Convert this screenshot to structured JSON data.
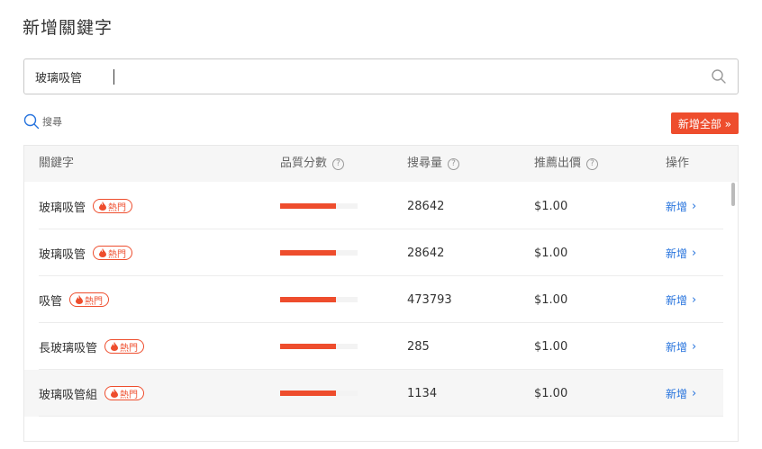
{
  "page": {
    "title": "新增關鍵字"
  },
  "search": {
    "value": "玻璃吸管",
    "placeholder": ""
  },
  "search_link": {
    "label": "搜尋"
  },
  "add_all": {
    "label": "新增全部 »"
  },
  "colors": {
    "accent": "#ee4d2d",
    "link": "#2673dd"
  },
  "table": {
    "headers": {
      "keyword": "關鍵字",
      "quality": "品質分數",
      "volume": "搜尋量",
      "bid": "推薦出價",
      "action": "操作"
    },
    "hot_label": "熱門",
    "add_label": "新增",
    "rows": [
      {
        "keyword": "玻璃吸管",
        "quality": 0.72,
        "volume": "28642",
        "bid": "$1.00"
      },
      {
        "keyword": "玻璃吸管",
        "quality": 0.72,
        "volume": "28642",
        "bid": "$1.00"
      },
      {
        "keyword": "吸管",
        "quality": 0.72,
        "volume": "473793",
        "bid": "$1.00"
      },
      {
        "keyword": "長玻璃吸管",
        "quality": 0.72,
        "volume": "285",
        "bid": "$1.00"
      },
      {
        "keyword": "玻璃吸管組",
        "quality": 0.72,
        "volume": "1134",
        "bid": "$1.00"
      }
    ]
  }
}
